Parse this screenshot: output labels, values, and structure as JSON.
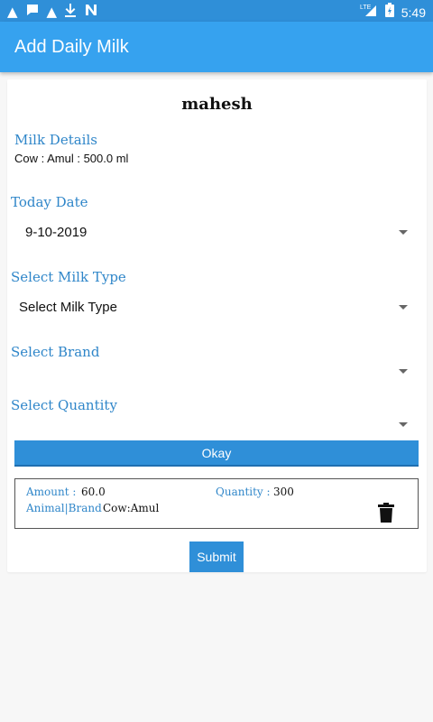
{
  "status_bar": {
    "time": "5:49",
    "network": "LTE",
    "left_icons": [
      "warning-icon",
      "chat-icon",
      "warning-icon",
      "download-icon",
      "n-icon"
    ],
    "color": "#2f8fd8"
  },
  "app_bar": {
    "title": "Add Daily Milk",
    "color": "#36a2ef"
  },
  "form": {
    "user_name": "mahesh",
    "milk_details_label": "Milk Details",
    "milk_details_value": "Cow : Amul : 500.0 ml",
    "today_date_label": "Today Date",
    "today_date_value": "9-10-2019",
    "milk_type_label": "Select Milk Type",
    "milk_type_value": "Select Milk Type",
    "brand_label": "Select Brand",
    "brand_value": "",
    "quantity_label": "Select Quantity",
    "quantity_value": "",
    "okay_label": "Okay"
  },
  "entry": {
    "amount_label": "Amount :",
    "amount_value": "60.0",
    "quantity_label": "Quantity :",
    "quantity_value": "300",
    "animal_brand_label": "Animal|Brand",
    "animal_brand_value": "Cow:Amul"
  },
  "submit_label": "Submit",
  "accent_color": "#2f86c9"
}
